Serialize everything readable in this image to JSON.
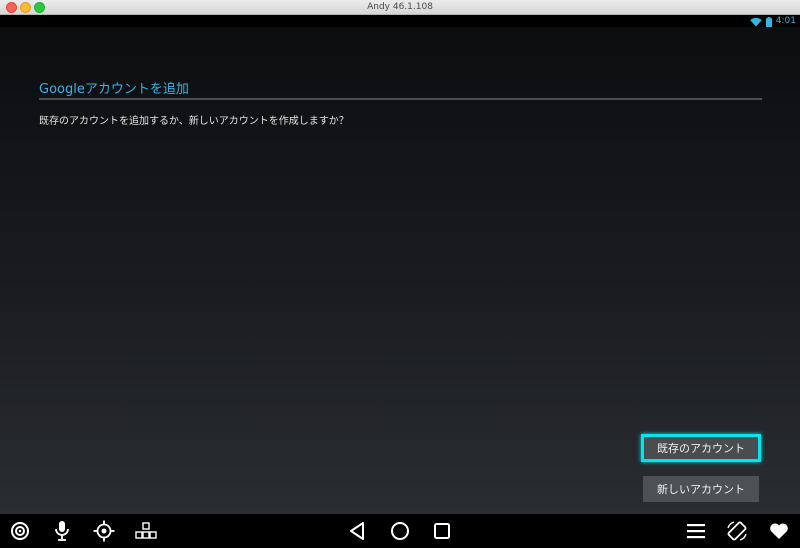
{
  "window": {
    "title": "Andy 46.1.108"
  },
  "statusbar": {
    "time": "4:01",
    "accent": "#33b5e5"
  },
  "dialog": {
    "title": "Googleアカウントを追加",
    "message": "既存のアカウントを追加するか、新しいアカウントを作成しますか？",
    "buttons": {
      "existing_label": "既存のアカウント",
      "new_label": "新しいアカウント"
    },
    "focus_color": "#00e5ee"
  },
  "toolbar": {
    "left_icons": [
      "target-icon",
      "microphone-icon",
      "gps-icon",
      "keyboard-map-icon"
    ],
    "center_icons": [
      "back-icon",
      "home-icon",
      "recents-icon"
    ],
    "right_icons": [
      "menu-icon",
      "rotate-icon",
      "heart-icon"
    ]
  }
}
